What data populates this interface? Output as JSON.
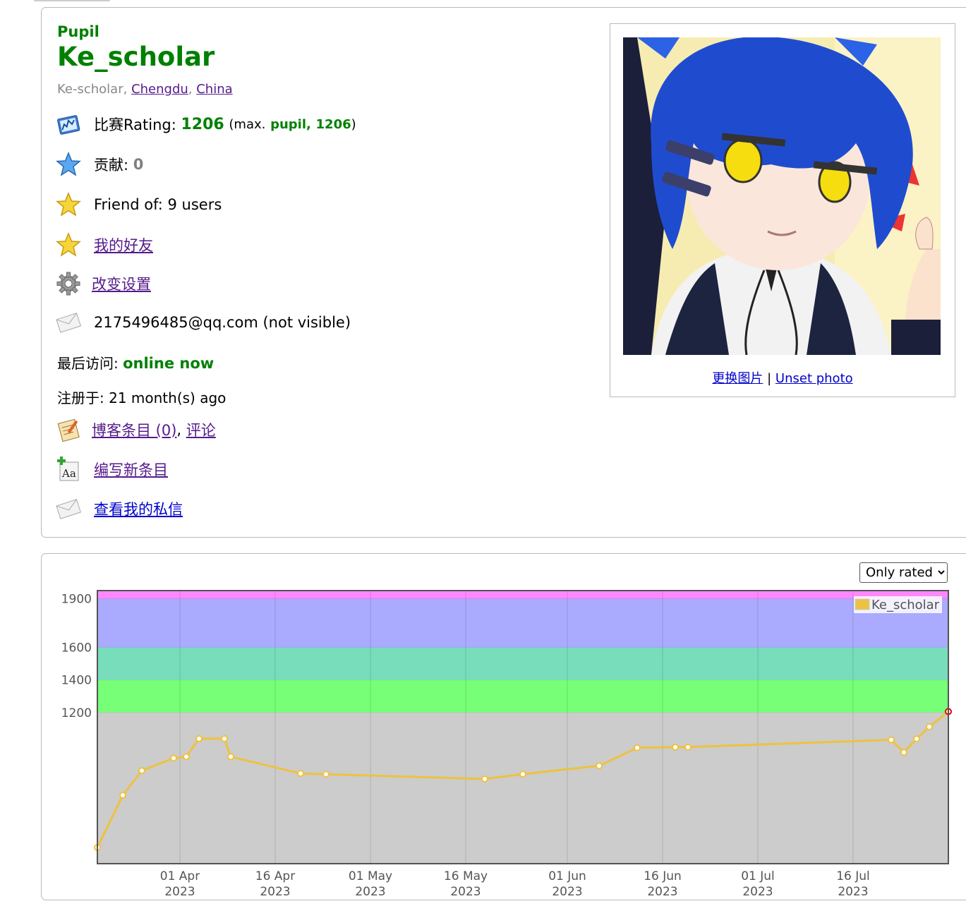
{
  "profile": {
    "rank": "Pupil",
    "handle": "Ke_scholar",
    "name": "Ke-scholar",
    "city": "Chengdu",
    "country": "China",
    "rating_label": "比赛Rating:",
    "rating": "1206",
    "max_open": "(max.",
    "max_rank": "pupil,",
    "max_rating": "1206",
    "max_close": ")",
    "contribution_label": "贡献:",
    "contribution": "0",
    "friend_of": "Friend of: 9 users",
    "my_friends": "我的好友",
    "settings": "改变设置",
    "email": "2175496485@qq.com (not visible)",
    "last_visit_label": "最后访问:",
    "last_visit": "online now",
    "registered_label": "注册于:",
    "registered": "21 month(s) ago",
    "blog_entries": "博客条目 (0)",
    "comments": "评论",
    "write_entry": "编写新条目",
    "messages": "查看我的私信"
  },
  "photo": {
    "change": "更换图片",
    "separator": "|",
    "unset": "Unset photo"
  },
  "graph": {
    "filter_options": [
      "Only rated"
    ],
    "selected_filter": "Only rated"
  },
  "colors": {
    "rank_green": "#008000",
    "band_gray": "#cccccc",
    "band_green": "#77ff77",
    "band_cyan": "#77ddbb",
    "band_blue": "#aaaaff",
    "band_violet": "#ff88ff",
    "line": "#edc240"
  },
  "chart_data": {
    "type": "line",
    "legend": "Ke_scholar",
    "legend_position": "top-right",
    "y_ticks": [
      1200,
      1400,
      1600,
      1900
    ],
    "ylim": [
      270,
      1950
    ],
    "bands": [
      {
        "from": 0,
        "to": 1200,
        "color": "#cccccc"
      },
      {
        "from": 1200,
        "to": 1400,
        "color": "#77ff77"
      },
      {
        "from": 1400,
        "to": 1600,
        "color": "#77ddbb"
      },
      {
        "from": 1600,
        "to": 1900,
        "color": "#aaaaff"
      },
      {
        "from": 1900,
        "to": 2100,
        "color": "#ff88ff"
      }
    ],
    "x_range": [
      "2023-03-19",
      "2023-07-31"
    ],
    "x_ticks": [
      {
        "date": "2023-04-01",
        "line1": "01 Apr",
        "line2": "2023"
      },
      {
        "date": "2023-04-16",
        "line1": "16 Apr",
        "line2": "2023"
      },
      {
        "date": "2023-05-01",
        "line1": "01 May",
        "line2": "2023"
      },
      {
        "date": "2023-05-16",
        "line1": "16 May",
        "line2": "2023"
      },
      {
        "date": "2023-06-01",
        "line1": "01 Jun",
        "line2": "2023"
      },
      {
        "date": "2023-06-16",
        "line1": "16 Jun",
        "line2": "2023"
      },
      {
        "date": "2023-07-01",
        "line1": "01 Jul",
        "line2": "2023"
      },
      {
        "date": "2023-07-16",
        "line1": "16 Jul",
        "line2": "2023"
      }
    ],
    "series": [
      {
        "name": "Ke_scholar",
        "points": [
          [
            "2023-03-19",
            369
          ],
          [
            "2023-03-23",
            691
          ],
          [
            "2023-03-26",
            842
          ],
          [
            "2023-03-31",
            919
          ],
          [
            "2023-04-02",
            928
          ],
          [
            "2023-04-04",
            1039
          ],
          [
            "2023-04-08",
            1039
          ],
          [
            "2023-04-09",
            928
          ],
          [
            "2023-04-20",
            825
          ],
          [
            "2023-04-24",
            820
          ],
          [
            "2023-05-19",
            791
          ],
          [
            "2023-05-25",
            821
          ],
          [
            "2023-06-06",
            872
          ],
          [
            "2023-06-12",
            983
          ],
          [
            "2023-06-18",
            987
          ],
          [
            "2023-06-20",
            987
          ],
          [
            "2023-07-22",
            1032
          ],
          [
            "2023-07-24",
            955
          ],
          [
            "2023-07-26",
            1038
          ],
          [
            "2023-07-28",
            1112
          ],
          [
            "2023-07-31",
            1206
          ]
        ]
      }
    ]
  }
}
